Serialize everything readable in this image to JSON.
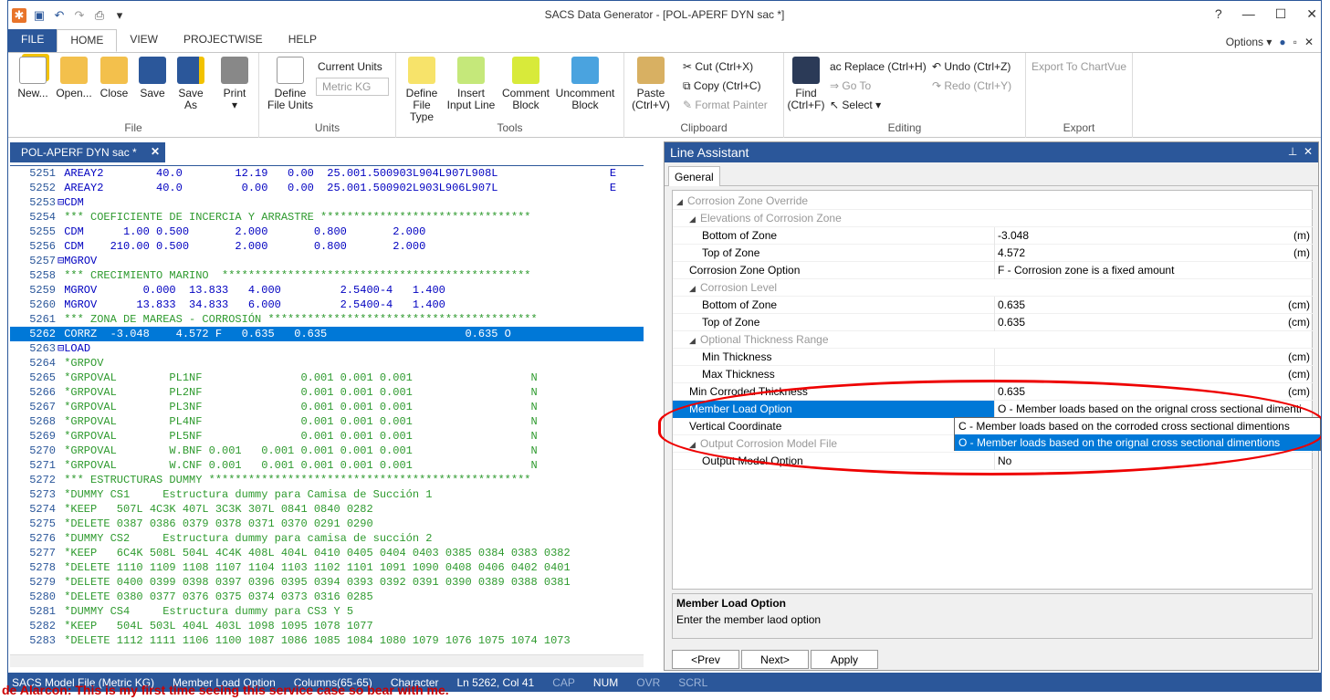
{
  "window": {
    "title": "SACS Data Generator - [POL-APERF DYN sac *]"
  },
  "menu_tabs": [
    "FILE",
    "HOME",
    "VIEW",
    "PROJECTWISE",
    "HELP"
  ],
  "options_label": "Options",
  "ribbon": {
    "file_group": {
      "label": "File",
      "new": "New...",
      "open": "Open...",
      "close": "Close",
      "save": "Save",
      "save_as_1": "Save",
      "save_as_2": "As",
      "print": "Print"
    },
    "units_group": {
      "label": "Units",
      "define_1": "Define",
      "define_2": "File Units",
      "current_units_label": "Current Units",
      "current_units_value": "Metric KG"
    },
    "tools_group": {
      "label": "Tools",
      "define_type_1": "Define",
      "define_type_2": "File Type",
      "insert_1": "Insert",
      "insert_2": "Input Line",
      "comment_1": "Comment",
      "comment_2": "Block",
      "uncomment_1": "Uncomment",
      "uncomment_2": "Block"
    },
    "clipboard_group": {
      "label": "Clipboard",
      "paste_1": "Paste",
      "paste_2": "(Ctrl+V)",
      "cut": "Cut (Ctrl+X)",
      "copy": "Copy (Ctrl+C)",
      "format_painter": "Format Painter"
    },
    "editing_group": {
      "label": "Editing",
      "find_1": "Find",
      "find_2": "(Ctrl+F)",
      "replace": "Replace (Ctrl+H)",
      "goto": "Go To",
      "select": "Select",
      "undo": "Undo (Ctrl+Z)",
      "redo": "Redo (Ctrl+Y)"
    },
    "export_group": {
      "label": "Export",
      "export_chartvue": "Export To ChartVue"
    }
  },
  "doc_tab": "POL-APERF DYN sac *",
  "editor_lines": [
    {
      "n": "5251",
      "t": " AREAY2        40.0        12.19   0.00  25.001.500903L904L907L908L                 E",
      "c": "t-blue"
    },
    {
      "n": "5252",
      "t": " AREAY2        40.0         0.00   0.00  25.001.500902L903L906L907L                 E",
      "c": "t-blue"
    },
    {
      "n": "5253",
      "t": "⊟CDM",
      "c": "t-blue"
    },
    {
      "n": "5254",
      "t": " *** COEFICIENTE DE INCERCIA Y ARRASTRE ********************************",
      "c": "t-green"
    },
    {
      "n": "5255",
      "t": " CDM      1.00 0.500       2.000       0.800       2.000",
      "c": "t-blue"
    },
    {
      "n": "5256",
      "t": " CDM    210.00 0.500       2.000       0.800       2.000",
      "c": "t-blue"
    },
    {
      "n": "5257",
      "t": "⊟MGROV",
      "c": "t-blue"
    },
    {
      "n": "5258",
      "t": " *** CRECIMIENTO MARINO  ***********************************************",
      "c": "t-green"
    },
    {
      "n": "5259",
      "t": " MGROV       0.000  13.833   4.000         2.5400-4   1.400",
      "c": "t-blue"
    },
    {
      "n": "5260",
      "t": " MGROV      13.833  34.833   6.000         2.5400-4   1.400",
      "c": "t-blue"
    },
    {
      "n": "5261",
      "t": " *** ZONA DE MAREAS - CORROSIÓN *****************************************",
      "c": "t-green"
    },
    {
      "n": "5262",
      "t": " CORRZ  -3.048    4.572 F   0.635   0.635                     0.635 O",
      "c": "sel"
    },
    {
      "n": "5263",
      "t": "⊟LOAD",
      "c": "t-blue"
    },
    {
      "n": "5264",
      "t": " *GRPOV",
      "c": "t-green"
    },
    {
      "n": "5265",
      "t": " *GRPOVAL        PL1NF               0.001 0.001 0.001                  N",
      "c": "t-green"
    },
    {
      "n": "5266",
      "t": " *GRPOVAL        PL2NF               0.001 0.001 0.001                  N",
      "c": "t-green"
    },
    {
      "n": "5267",
      "t": " *GRPOVAL        PL3NF               0.001 0.001 0.001                  N",
      "c": "t-green"
    },
    {
      "n": "5268",
      "t": " *GRPOVAL        PL4NF               0.001 0.001 0.001                  N",
      "c": "t-green"
    },
    {
      "n": "5269",
      "t": " *GRPOVAL        PL5NF               0.001 0.001 0.001                  N",
      "c": "t-green"
    },
    {
      "n": "5270",
      "t": " *GRPOVAL        W.BNF 0.001   0.001 0.001 0.001 0.001                  N",
      "c": "t-green"
    },
    {
      "n": "5271",
      "t": " *GRPOVAL        W.CNF 0.001   0.001 0.001 0.001 0.001                  N",
      "c": "t-green"
    },
    {
      "n": "5272",
      "t": " *** ESTRUCTURAS DUMMY *************************************************",
      "c": "t-green"
    },
    {
      "n": "5273",
      "t": " *DUMMY CS1     Estructura dummy para Camisa de Succión 1",
      "c": "t-green"
    },
    {
      "n": "5274",
      "t": " *KEEP   507L 4C3K 407L 3C3K 307L 0841 0840 0282",
      "c": "t-green"
    },
    {
      "n": "5275",
      "t": " *DELETE 0387 0386 0379 0378 0371 0370 0291 0290",
      "c": "t-green"
    },
    {
      "n": "5276",
      "t": " *DUMMY CS2     Estructura dummy para camisa de succión 2",
      "c": "t-green"
    },
    {
      "n": "5277",
      "t": " *KEEP   6C4K 508L 504L 4C4K 408L 404L 0410 0405 0404 0403 0385 0384 0383 0382",
      "c": "t-green"
    },
    {
      "n": "5278",
      "t": " *DELETE 1110 1109 1108 1107 1104 1103 1102 1101 1091 1090 0408 0406 0402 0401",
      "c": "t-green"
    },
    {
      "n": "5279",
      "t": " *DELETE 0400 0399 0398 0397 0396 0395 0394 0393 0392 0391 0390 0389 0388 0381",
      "c": "t-green"
    },
    {
      "n": "5280",
      "t": " *DELETE 0380 0377 0376 0375 0374 0373 0316 0285",
      "c": "t-green"
    },
    {
      "n": "5281",
      "t": " *DUMMY CS4     Estructura dummy para CS3 Y 5",
      "c": "t-green"
    },
    {
      "n": "5282",
      "t": " *KEEP   504L 503L 404L 403L 1098 1095 1078 1077",
      "c": "t-green"
    },
    {
      "n": "5283",
      "t": " *DELETE 1112 1111 1106 1100 1087 1086 1085 1084 1080 1079 1076 1075 1074 1073",
      "c": "t-green"
    }
  ],
  "line_assistant": {
    "title": "Line Assistant",
    "tab": "General",
    "rows": [
      {
        "k": "Corrosion Zone Override",
        "v": "",
        "u": "",
        "level": 0,
        "cat": true
      },
      {
        "k": "Elevations of Corrosion Zone",
        "v": "",
        "u": "",
        "level": 1,
        "cat": true
      },
      {
        "k": "Bottom of Zone",
        "v": "-3.048",
        "u": "(m)",
        "level": 2
      },
      {
        "k": "Top of Zone",
        "v": "4.572",
        "u": "(m)",
        "level": 2
      },
      {
        "k": "Corrosion Zone Option",
        "v": "F - Corrosion zone is a fixed amount",
        "u": "",
        "level": 1
      },
      {
        "k": "Corrosion Level",
        "v": "",
        "u": "",
        "level": 1,
        "cat": true
      },
      {
        "k": "Bottom of Zone",
        "v": "0.635",
        "u": "(cm)",
        "level": 2
      },
      {
        "k": "Top of Zone",
        "v": "0.635",
        "u": "(cm)",
        "level": 2
      },
      {
        "k": "Optional Thickness Range",
        "v": "",
        "u": "",
        "level": 1,
        "cat": true
      },
      {
        "k": "Min Thickness",
        "v": "",
        "u": "(cm)",
        "level": 2
      },
      {
        "k": "Max Thickness",
        "v": "",
        "u": "(cm)",
        "level": 2
      },
      {
        "k": "Min Corroded Thickness",
        "v": "0.635",
        "u": "(cm)",
        "level": 1
      },
      {
        "k": "Member Load Option",
        "v": "O - Member loads based on the orignal cross sectional dimenti",
        "u": "",
        "level": 1,
        "sel": true
      },
      {
        "k": "Vertical Coordinate",
        "v": "",
        "u": "",
        "level": 1
      },
      {
        "k": "Output Corrosion Model File",
        "v": "",
        "u": "",
        "level": 1,
        "cat": true
      },
      {
        "k": "Output Model Option",
        "v": "No",
        "u": "",
        "level": 2
      }
    ],
    "dropdown_options": [
      "C - Member loads based on the corroded cross sectional dimentions",
      "O - Member loads based on the orignal cross sectional dimentions"
    ],
    "desc_title": "Member Load Option",
    "desc_body": "Enter the member laod option",
    "prev": "<Prev",
    "next": "Next>",
    "apply": "Apply"
  },
  "status_bar": [
    "SACS Model File (Metric KG)",
    "Member Load Option",
    "Columns(65-65)",
    "Character",
    "Ln 5262, Col 41",
    "CAP",
    "NUM",
    "OVR",
    "SCRL"
  ],
  "behind_text": "de Alarcon: This is my first time seeing this service case so bear with me."
}
